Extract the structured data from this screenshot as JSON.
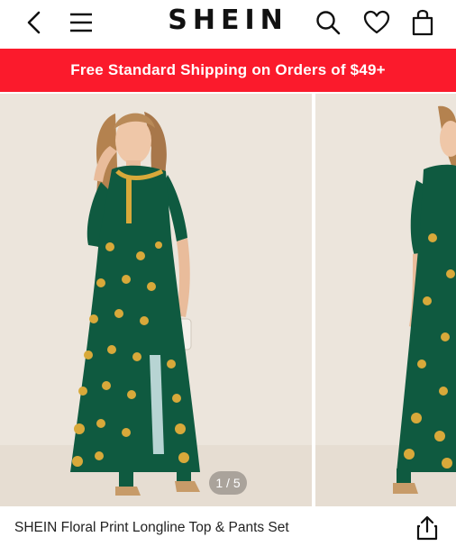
{
  "header": {
    "logo": "SHEIN",
    "back_icon": "chevron-left-icon",
    "menu_icon": "hamburger-menu-icon",
    "search_icon": "search-icon",
    "wishlist_icon": "heart-icon",
    "bag_icon": "shopping-bag-icon"
  },
  "promo": {
    "text": "Free Standard Shipping on Orders of $49+",
    "background": "#fb1a2c",
    "color": "#ffffff"
  },
  "gallery": {
    "counter": "1 / 5",
    "current": 1,
    "total": 5,
    "slides": [
      {
        "alt": "Model wearing green floral print longline top and pants"
      },
      {
        "alt": "Side view of green floral print longline top"
      }
    ]
  },
  "product": {
    "title": "SHEIN Floral Print Longline Top & Pants Set",
    "share_icon": "share-icon"
  },
  "colors": {
    "dress_green": "#0f5a40",
    "gold_print": "#d8a93a",
    "backdrop": "#ece5dc"
  }
}
